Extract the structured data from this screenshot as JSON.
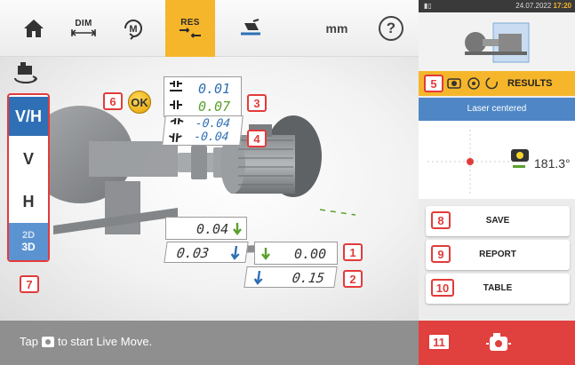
{
  "toolbar": {
    "home_icon": "home-icon",
    "dim_label": "DIM",
    "measure_label": "M",
    "res_label": "RES",
    "units": "mm",
    "help": "?",
    "active_tab": "RES",
    "accent": "#f6b62b"
  },
  "view_selector": {
    "options": [
      "V/H",
      "V",
      "H"
    ],
    "view_2d": "2D",
    "view_3d": "3D",
    "selected": "V/H",
    "callout": "7"
  },
  "coupling": {
    "ok_text": "OK",
    "callout_ok": "6",
    "gap_values": [
      "0.01",
      "0.07"
    ],
    "gap_callout": "3",
    "angle_values": [
      "-0.04",
      "-0.04"
    ],
    "angle_callout": "4"
  },
  "feet": {
    "front_upper": "0.04",
    "front_lower": "0.03",
    "rear_upper": "0.00",
    "rear_lower": "0.15",
    "callout_upper": "1",
    "callout_lower": "2"
  },
  "status": {
    "prefix": "Tap",
    "suffix": "to start Live Move."
  },
  "right_panel": {
    "sys_left": "",
    "sys_date": "24.07.2022",
    "sys_time": "17:20",
    "results_callout": "5",
    "results_title": "RESULTS",
    "laser_status": "Laser centered",
    "angle": "181.3°",
    "buttons": [
      {
        "callout": "8",
        "label": "SAVE"
      },
      {
        "callout": "9",
        "label": "REPORT"
      },
      {
        "callout": "10",
        "label": "TABLE"
      }
    ],
    "livemove_callout": "11",
    "livemove_color": "#e0413e"
  }
}
